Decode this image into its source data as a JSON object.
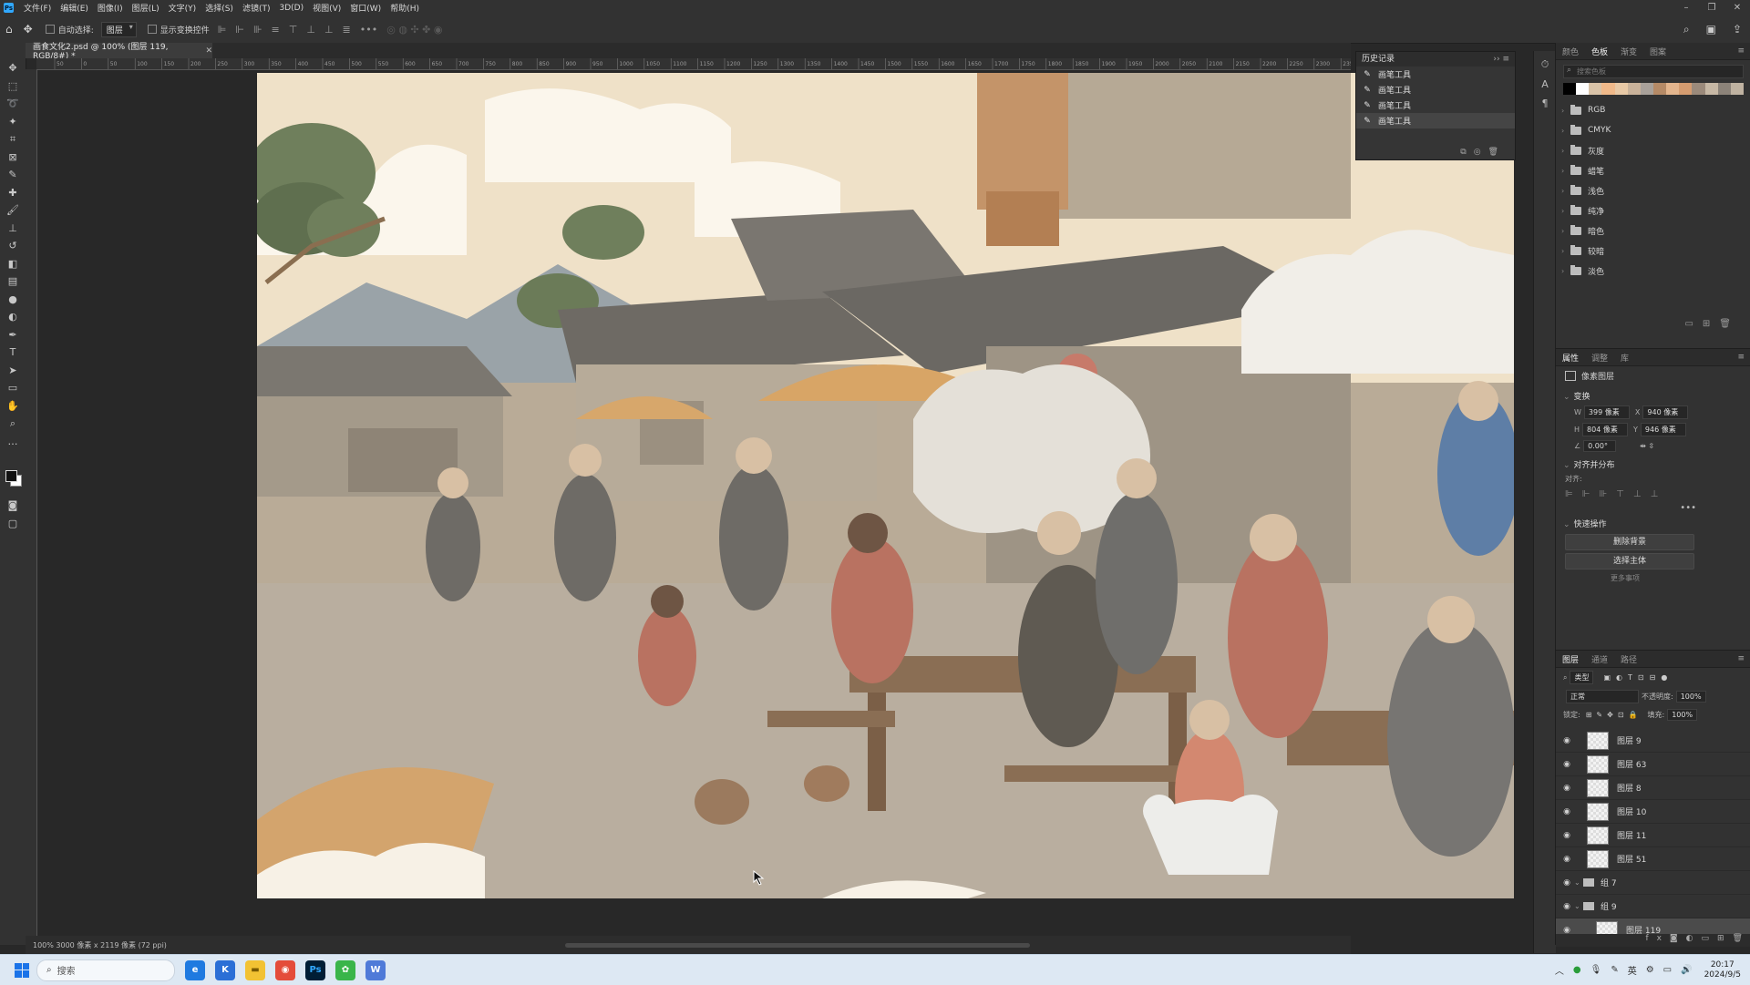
{
  "app": {
    "menu": [
      "文件(F)",
      "编辑(E)",
      "图像(I)",
      "图层(L)",
      "文字(Y)",
      "选择(S)",
      "滤镜(T)",
      "3D(D)",
      "视图(V)",
      "窗口(W)",
      "帮助(H)"
    ],
    "window_controls": [
      "–",
      "❐",
      "✕"
    ]
  },
  "options_bar": {
    "auto_select_label": "自动选择:",
    "auto_select_value": "图层",
    "show_transform_label": "显示变换控件"
  },
  "document": {
    "tab_title": "画食文化2.psd @ 100% (图层 119, RGB/8#) *",
    "status": "100%    3000 像素 x 2119 像素 (72 ppi)"
  },
  "ruler_labels": [
    "50",
    "0",
    "50",
    "100",
    "150",
    "200",
    "250",
    "300",
    "350",
    "400",
    "450",
    "500",
    "550",
    "600",
    "650",
    "700",
    "750",
    "800",
    "850",
    "900",
    "950",
    "1000",
    "1050",
    "1100",
    "1150",
    "1200",
    "1250",
    "1300",
    "1350",
    "1400",
    "1450",
    "1500",
    "1550",
    "1600",
    "1650",
    "1700",
    "1750",
    "1800",
    "1850",
    "1900",
    "1950",
    "2000",
    "2050",
    "2100",
    "2150",
    "2200",
    "2250",
    "2300",
    "2350"
  ],
  "history": {
    "title": "历史记录",
    "items": [
      "画笔工具",
      "画笔工具",
      "画笔工具",
      "画笔工具"
    ],
    "selected_index": 3
  },
  "swatches_panel": {
    "tabs": [
      "颜色",
      "色板",
      "渐变",
      "图案"
    ],
    "active_tab": 1,
    "search_placeholder": "搜索色板",
    "recent_colors": [
      "#000000",
      "#ffffff",
      "#d9c3a8",
      "#f0b98a",
      "#e8c9a6",
      "#c9b29a",
      "#a9a19a",
      "#b58a66",
      "#e3b58d",
      "#d59c70",
      "#9b8a7b",
      "#c7b8a5",
      "#8c8379",
      "#bfb2a1"
    ],
    "groups": [
      "RGB",
      "CMYK",
      "灰度",
      "蜡笔",
      "浅色",
      "纯净",
      "暗色",
      "较暗",
      "淡色"
    ]
  },
  "properties_panel": {
    "tabs": [
      "属性",
      "调整",
      "库"
    ],
    "kind": "像素图层",
    "transform_title": "变换",
    "w": "399 像素",
    "x": "940 像素",
    "h": "804 像素",
    "y": "946 像素",
    "angle": "0.00°",
    "align_title": "对齐并分布",
    "align_label": "对齐:",
    "quick_title": "快速操作",
    "btn_remove_bg": "删除背景",
    "btn_select_subject": "选择主体",
    "more": "更多事项"
  },
  "layers_panel": {
    "tabs": [
      "图层",
      "通道",
      "路径"
    ],
    "filter_label": "类型",
    "blend_mode": "正常",
    "opacity_label": "不透明度:",
    "opacity": "100%",
    "lock_label": "锁定:",
    "fill_label": "填充:",
    "fill": "100%",
    "layers": [
      {
        "name": "图层 9",
        "type": "layer"
      },
      {
        "name": "图层 63",
        "type": "layer"
      },
      {
        "name": "图层 8",
        "type": "layer"
      },
      {
        "name": "图层 10",
        "type": "layer"
      },
      {
        "name": "图层 11",
        "type": "layer"
      },
      {
        "name": "图层 51",
        "type": "layer"
      },
      {
        "name": "组 7",
        "type": "group"
      },
      {
        "name": "组 9",
        "type": "group"
      },
      {
        "name": "图层 119",
        "type": "layer",
        "selected": true
      }
    ]
  },
  "taskbar": {
    "search_placeholder": "搜索",
    "time": "20:17",
    "date": "2024/9/5",
    "ime": "英"
  }
}
